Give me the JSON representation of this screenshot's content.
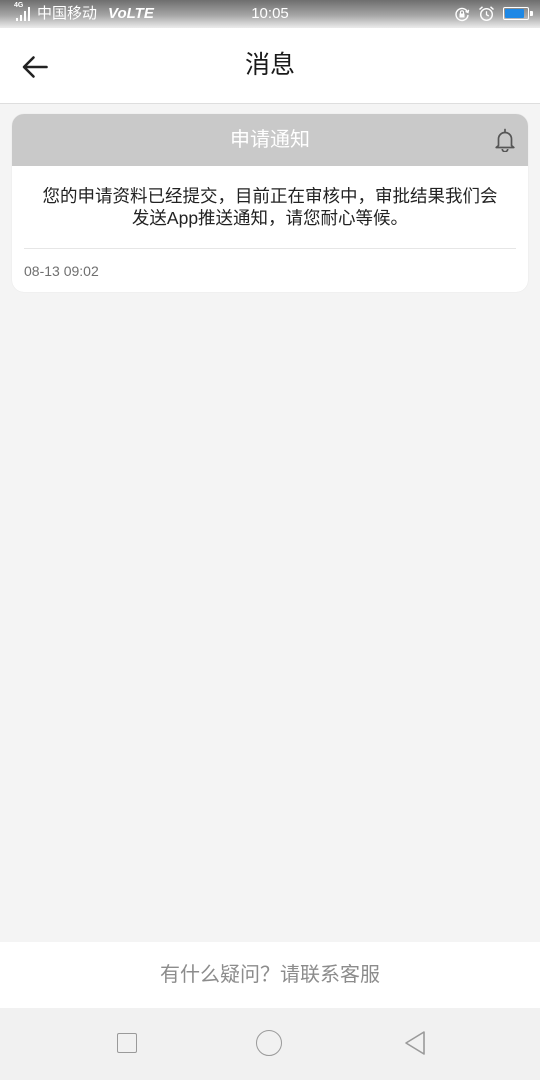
{
  "status_bar": {
    "network_type": "4G",
    "carrier": "中国移动",
    "volte": "VoLTE",
    "time": "10:05",
    "battery_level": 0.85,
    "icons": [
      "signal-strength-icon",
      "rotation-lock-icon",
      "alarm-clock-icon",
      "battery-icon"
    ]
  },
  "header": {
    "title": "消息",
    "back_icon": "arrow-left-icon"
  },
  "notifications": [
    {
      "title": "申请通知",
      "icon": "bell-icon",
      "message": "您的申请资料已经提交，目前正在审核中，审批结果我们会发送App推送通知，请您耐心等候。",
      "time": "08-13 09:02"
    }
  ],
  "footer": {
    "help_text": "有什么疑问？请联系客服"
  },
  "nav_bar": {
    "icons": [
      "square-recents-icon",
      "circle-home-icon",
      "triangle-back-icon"
    ]
  },
  "colors": {
    "page_background": "#f4f4f4",
    "card_header_background": "#c9c9c9",
    "card_header_text": "#ffffff",
    "timestamp_text": "#6f6f6f",
    "footer_text": "#8c8c8c",
    "battery_fill": "#1e88e5"
  }
}
